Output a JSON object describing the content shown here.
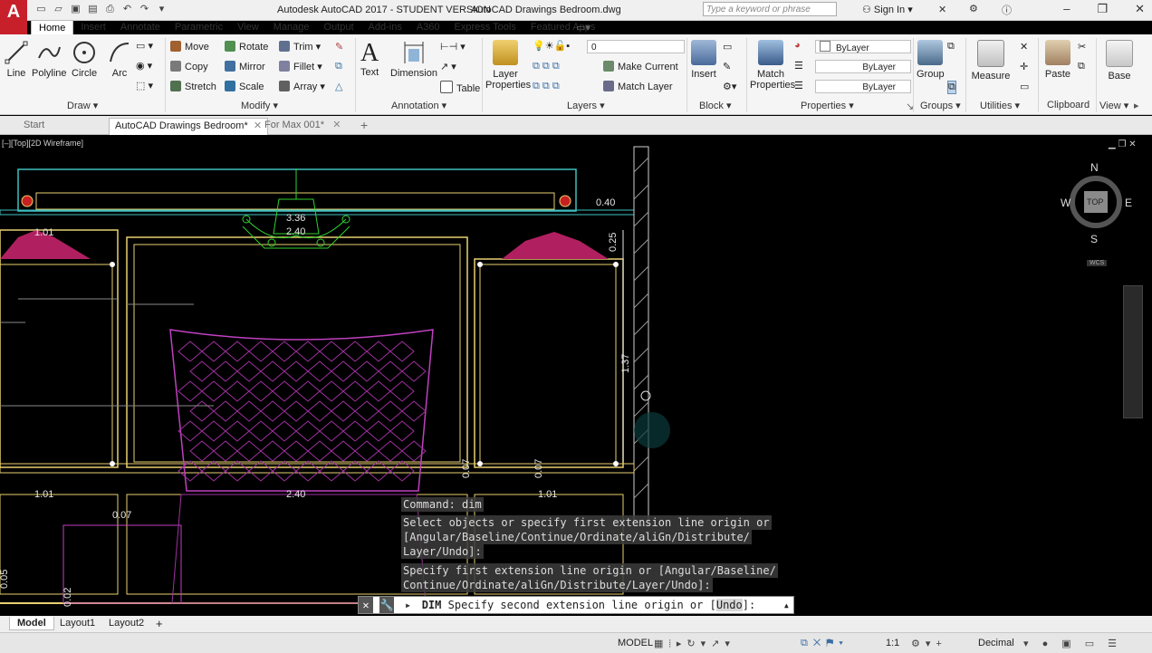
{
  "app": {
    "title": "Autodesk AutoCAD 2017 - STUDENT VERSION",
    "filename": "AutoCAD Drawings Bedroom.dwg",
    "logo_letter": "A",
    "search_placeholder": "Type a keyword or phrase",
    "signin": "Sign In"
  },
  "ribbon_tabs": [
    "Home",
    "Insert",
    "Annotate",
    "Parametric",
    "View",
    "Manage",
    "Output",
    "Add-ins",
    "A360",
    "Express Tools",
    "Featured Apps"
  ],
  "ribbon": {
    "draw": {
      "line": "Line",
      "polyline": "Polyline",
      "circle": "Circle",
      "arc": "Arc",
      "label": "Draw"
    },
    "modify": {
      "move": "Move",
      "rotate": "Rotate",
      "trim": "Trim",
      "copy": "Copy",
      "mirror": "Mirror",
      "fillet": "Fillet",
      "stretch": "Stretch",
      "scale": "Scale",
      "array": "Array",
      "label": "Modify"
    },
    "annotation": {
      "text": "Text",
      "dimension": "Dimension",
      "table": "Table",
      "label": "Annotation"
    },
    "layers": {
      "layer_properties": "Layer\nProperties",
      "layer_value": "0",
      "make_current": "Make Current",
      "match_layer": "Match Layer",
      "label": "Layers"
    },
    "block": {
      "insert": "Insert",
      "label": "Block"
    },
    "properties": {
      "match_properties": "Match\nProperties",
      "bylayer1": "ByLayer",
      "bylayer2": "ByLayer",
      "bylayer3": "ByLayer",
      "label": "Properties"
    },
    "groups": {
      "group": "Group",
      "label": "Groups"
    },
    "utilities": {
      "measure": "Measure",
      "label": "Utilities"
    },
    "clipboard": {
      "paste": "Paste",
      "label": "Clipboard"
    },
    "view": {
      "base": "Base",
      "label": "View"
    }
  },
  "doc_tabs": [
    {
      "label": "Start"
    },
    {
      "label": "AutoCAD Drawings Bedroom*"
    },
    {
      "label": "For Max 001*"
    }
  ],
  "viewport_label": "[–][Top][2D Wireframe]",
  "viewcube": {
    "n": "N",
    "s": "S",
    "e": "E",
    "w": "W",
    "top": "TOP",
    "wcs": "WCS"
  },
  "dimensions": [
    "0.40",
    "1.01",
    "0.25",
    "3.36",
    "2.40",
    "1.37",
    "0.07",
    "0.07",
    "1.01",
    "2.40",
    "1.01",
    "0.07",
    "0.05",
    "0.02"
  ],
  "command_history": [
    "Command:  dim",
    "Select objects or specify first extension line origin or",
    "[Angular/Baseline/Continue/Ordinate/aliGn/Distribute/",
    "Layer/Undo]:",
    "Specify first extension line origin or [Angular/Baseline/",
    "Continue/Ordinate/aliGn/Distribute/Layer/Undo]:"
  ],
  "command_line": {
    "prefix": "DIM",
    "text": "Specify second extension line origin or [",
    "option": "Undo",
    "suffix": "]:"
  },
  "layout_tabs": [
    "Model",
    "Layout1",
    "Layout2"
  ],
  "status": {
    "model": "MODEL",
    "scale": "1:1",
    "units": "Decimal"
  },
  "colors": {
    "accent_red": "#c8202a",
    "magenta": "#c040c0",
    "yellow": "#e8d070",
    "cyan": "#40c0c0",
    "green": "#30d030"
  }
}
